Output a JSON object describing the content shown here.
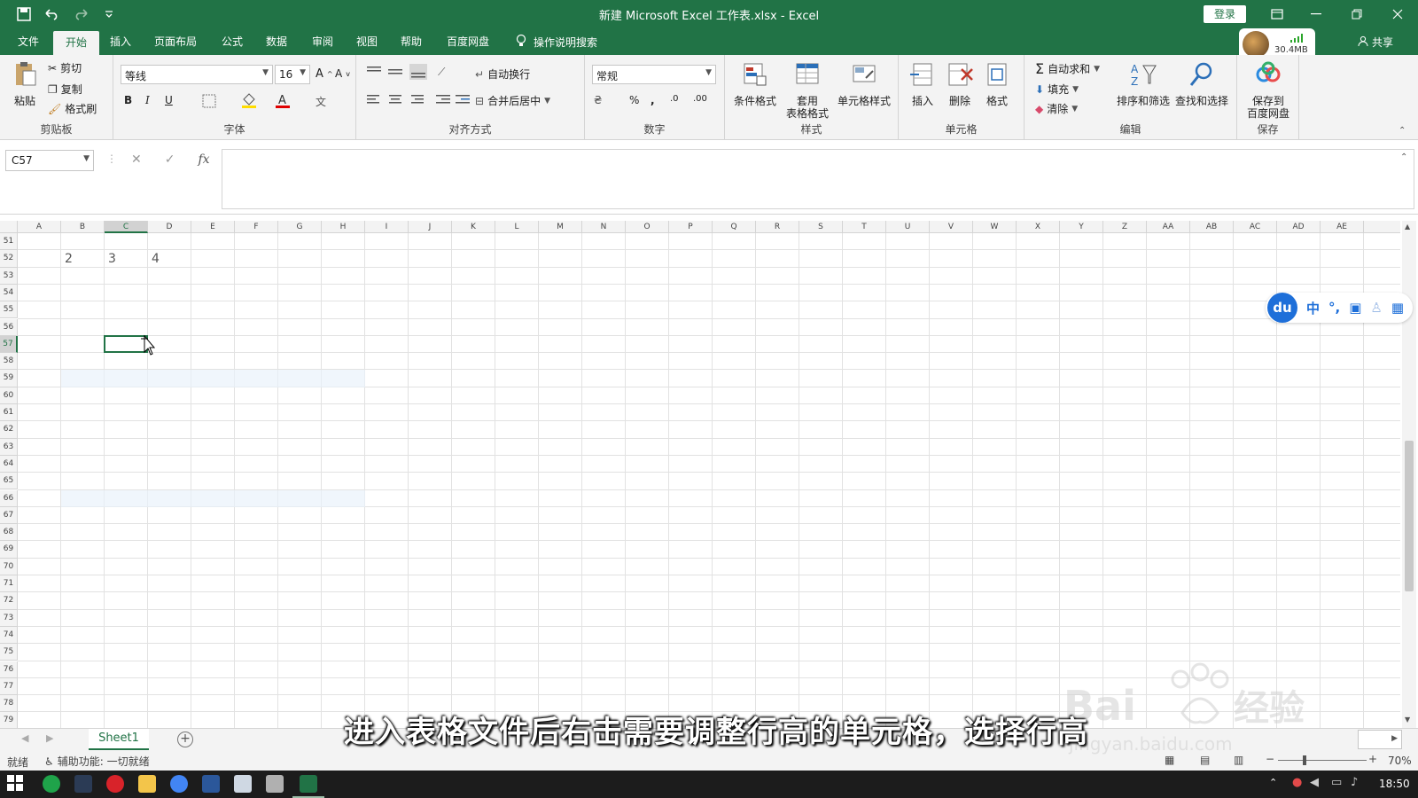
{
  "window": {
    "title": "新建 Microsoft Excel 工作表.xlsx  -  Excel",
    "login": "登录",
    "share": "共享",
    "memory": "30.4MB"
  },
  "tabs": [
    {
      "label": "文件"
    },
    {
      "label": "开始"
    },
    {
      "label": "插入"
    },
    {
      "label": "页面布局"
    },
    {
      "label": "公式"
    },
    {
      "label": "数据"
    },
    {
      "label": "审阅"
    },
    {
      "label": "视图"
    },
    {
      "label": "帮助"
    },
    {
      "label": "百度网盘"
    }
  ],
  "tell_me": "操作说明搜索",
  "ribbon": {
    "clipboard": {
      "label": "剪贴板",
      "paste": "粘贴",
      "cut": "剪切",
      "copy": "复制",
      "format_painter": "格式刷"
    },
    "font": {
      "label": "字体",
      "name": "等线",
      "size": "16",
      "bold": "B",
      "italic": "I",
      "underline": "U"
    },
    "alignment": {
      "label": "对齐方式",
      "wrap": "自动换行",
      "merge": "合并后居中"
    },
    "number": {
      "label": "数字",
      "format": "常规"
    },
    "styles": {
      "label": "样式",
      "conditional": "条件格式",
      "table_line1": "套用",
      "table_line2": "表格格式",
      "cell_styles": "单元格样式"
    },
    "cells": {
      "label": "单元格",
      "insert": "插入",
      "delete": "删除",
      "format": "格式"
    },
    "editing": {
      "label": "编辑",
      "autosum": "自动求和",
      "fill": "填充",
      "clear": "清除",
      "sort": "排序和筛选",
      "find": "查找和选择"
    },
    "save": {
      "label": "保存",
      "line1": "保存到",
      "line2": "百度网盘"
    }
  },
  "formula_bar": {
    "name_box": "C57",
    "fx": "fx"
  },
  "columns": [
    "A",
    "B",
    "C",
    "D",
    "E",
    "F",
    "G",
    "H",
    "I",
    "J",
    "K",
    "L",
    "M",
    "N",
    "O",
    "P",
    "Q",
    "R",
    "S",
    "T",
    "U",
    "V",
    "W",
    "X",
    "Y",
    "Z",
    "AA",
    "AB",
    "AC",
    "AD",
    "AE"
  ],
  "selected_column": "C",
  "rows": [
    "51",
    "52",
    "53",
    "54",
    "55",
    "56",
    "57",
    "58",
    "59",
    "60",
    "61",
    "62",
    "63",
    "64",
    "65",
    "66",
    "67",
    "68",
    "69",
    "70",
    "71",
    "72",
    "73",
    "74",
    "75",
    "76",
    "77",
    "78",
    "79"
  ],
  "selected_row": "57",
  "cells": [
    {
      "ref": "B52",
      "value": "2"
    },
    {
      "ref": "C52",
      "value": "3"
    },
    {
      "ref": "D52",
      "value": "4"
    }
  ],
  "sheets": [
    {
      "name": "Sheet1"
    }
  ],
  "status": {
    "ready": "就绪",
    "accessibility": "辅助功能: 一切就绪",
    "zoom": "70%"
  },
  "ime": {
    "logo": "du",
    "mode": "中"
  },
  "taskbar": {
    "time": "18:50"
  },
  "caption": "进入表格文件后右击需要调整行高的单元格，选择行高",
  "colors": {
    "accent": "#217346",
    "ribbon_bg": "#f3f3f3",
    "grid_line": "#e2e2e2",
    "ime_blue": "#1e6fd9"
  }
}
